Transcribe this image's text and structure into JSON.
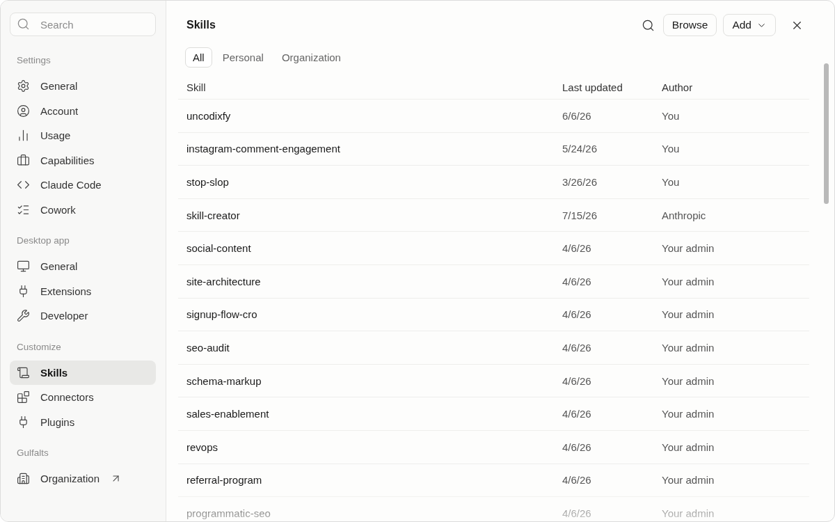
{
  "sidebar": {
    "search": {
      "placeholder": "Search"
    },
    "sections": [
      {
        "title": "Settings",
        "items": [
          {
            "label": "General",
            "selected": false
          },
          {
            "label": "Account",
            "selected": false
          },
          {
            "label": "Usage",
            "selected": false
          },
          {
            "label": "Capabilities",
            "selected": false
          },
          {
            "label": "Claude Code",
            "selected": false
          },
          {
            "label": "Cowork",
            "selected": false
          }
        ]
      },
      {
        "title": "Desktop app",
        "items": [
          {
            "label": "General",
            "selected": false
          },
          {
            "label": "Extensions",
            "selected": false
          },
          {
            "label": "Developer",
            "selected": false
          }
        ]
      },
      {
        "title": "Customize",
        "items": [
          {
            "label": "Skills",
            "selected": true
          },
          {
            "label": "Connectors",
            "selected": false
          },
          {
            "label": "Plugins",
            "selected": false
          }
        ]
      },
      {
        "title": "Gulfalts",
        "items": [
          {
            "label": "Organization",
            "selected": false,
            "external": true
          }
        ]
      }
    ]
  },
  "header": {
    "title": "Skills",
    "buttons": [
      {
        "label": "Browse",
        "kind": "plain"
      },
      {
        "label": "Add",
        "kind": "menu"
      }
    ]
  },
  "tabs": [
    {
      "label": "All",
      "selected": true
    },
    {
      "label": "Personal",
      "selected": false
    },
    {
      "label": "Organization",
      "selected": false
    }
  ],
  "table": {
    "columns": [
      "Skill",
      "Last updated",
      "Author"
    ],
    "rows": [
      {
        "skill": "uncodixfy",
        "last_updated": "6/6/26",
        "author": "You"
      },
      {
        "skill": "instagram-comment-engagement",
        "last_updated": "5/24/26",
        "author": "You"
      },
      {
        "skill": "stop-slop",
        "last_updated": "3/26/26",
        "author": "You"
      },
      {
        "skill": "skill-creator",
        "last_updated": "7/15/26",
        "author": "Anthropic"
      },
      {
        "skill": "social-content",
        "last_updated": "4/6/26",
        "author": "Your admin"
      },
      {
        "skill": "site-architecture",
        "last_updated": "4/6/26",
        "author": "Your admin"
      },
      {
        "skill": "signup-flow-cro",
        "last_updated": "4/6/26",
        "author": "Your admin"
      },
      {
        "skill": "seo-audit",
        "last_updated": "4/6/26",
        "author": "Your admin"
      },
      {
        "skill": "schema-markup",
        "last_updated": "4/6/26",
        "author": "Your admin"
      },
      {
        "skill": "sales-enablement",
        "last_updated": "4/6/26",
        "author": "Your admin"
      },
      {
        "skill": "revops",
        "last_updated": "4/6/26",
        "author": "Your admin"
      },
      {
        "skill": "referral-program",
        "last_updated": "4/6/26",
        "author": "Your admin"
      },
      {
        "skill": "programmatic-seo",
        "last_updated": "4/6/26",
        "author": "Your admin"
      }
    ]
  }
}
